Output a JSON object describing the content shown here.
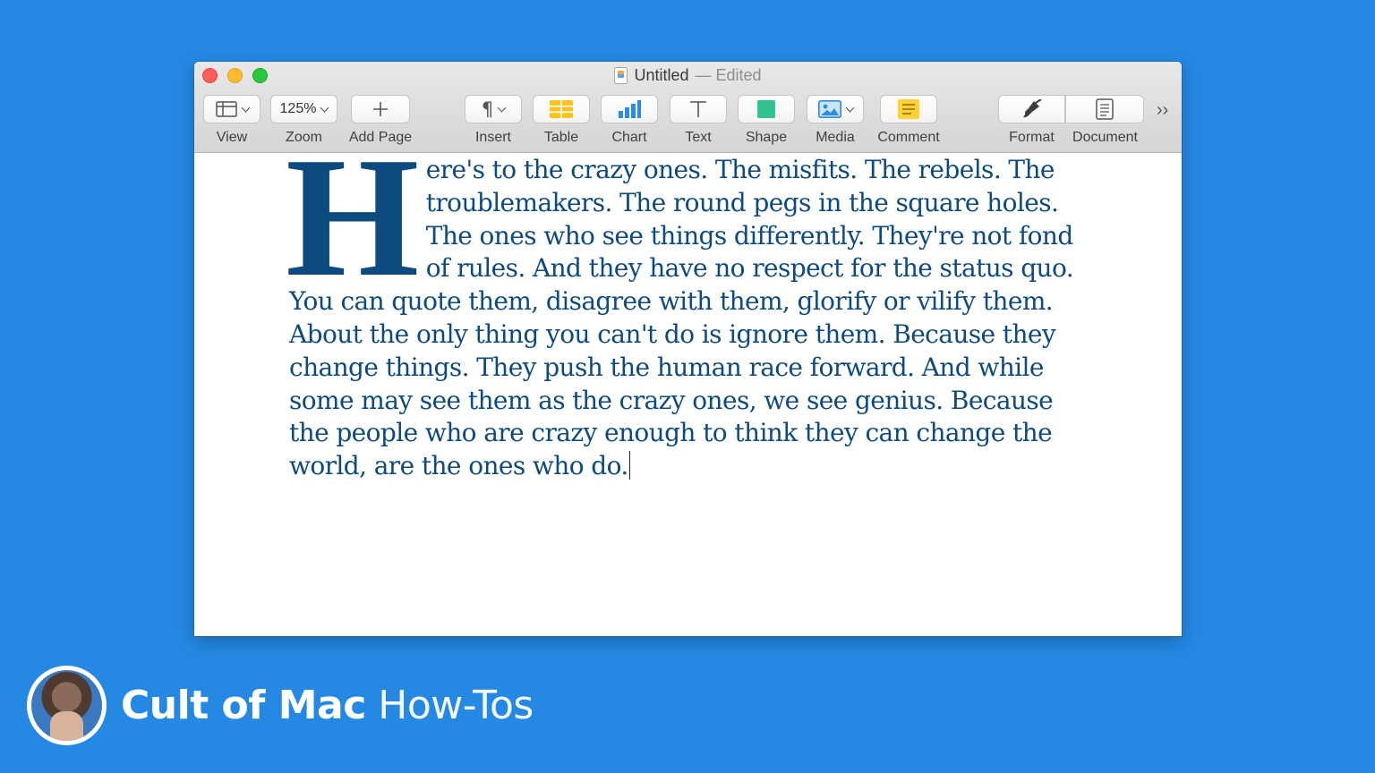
{
  "window": {
    "title": "Untitled",
    "status": "— Edited"
  },
  "toolbar": {
    "view_label": "View",
    "zoom_label": "Zoom",
    "zoom_value": "125%",
    "add_page_label": "Add Page",
    "insert_label": "Insert",
    "table_label": "Table",
    "chart_label": "Chart",
    "text_label": "Text",
    "shape_label": "Shape",
    "media_label": "Media",
    "comment_label": "Comment",
    "format_label": "Format",
    "document_label": "Document",
    "overflow_glyph": "››"
  },
  "document": {
    "drop_cap": "H",
    "text": "ere's to the crazy ones. The misfits. The rebels. The troublemakers. The round pegs in the square holes. The ones who see things differently. They're not fond of rules. And they have no respect for the status quo. You can quote them, disagree with them, glorify or vilify them. About the only thing you can't do is ignore them. Because they change things. They push the human race forward. And while some may see them as the crazy ones, we see genius. Because the people who are crazy enough to think they can change the world, are the ones who do.",
    "text_color": "#0c4a80"
  },
  "brand": {
    "name_bold": "Cult of Mac",
    "name_light": " How-Tos"
  },
  "colors": {
    "background": "#2589e3",
    "table_icon": "#fcc21b",
    "chart_icon": "#2d8be0",
    "shape_icon": "#34c38f",
    "comment_icon": "#fdd034"
  }
}
